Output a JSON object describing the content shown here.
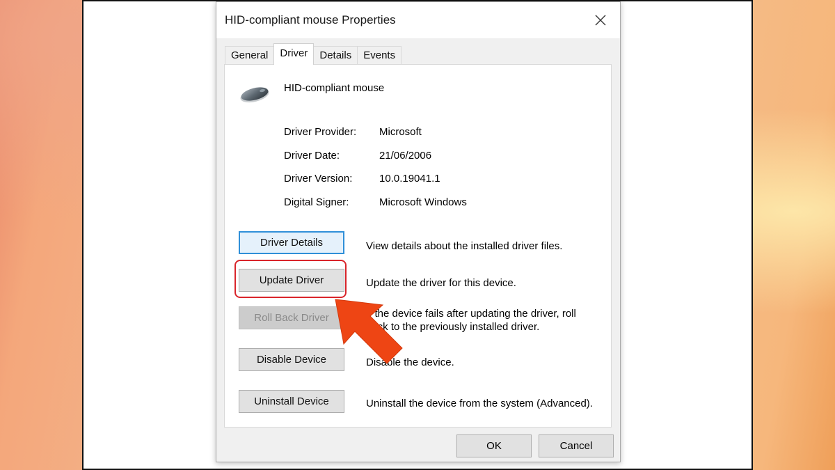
{
  "dialog": {
    "title": "HID-compliant mouse Properties",
    "close_icon": "close-icon"
  },
  "tabs": [
    {
      "label": "General",
      "active": false
    },
    {
      "label": "Driver",
      "active": true
    },
    {
      "label": "Details",
      "active": false
    },
    {
      "label": "Events",
      "active": false
    }
  ],
  "device": {
    "icon": "mouse-icon",
    "name": "HID-compliant mouse"
  },
  "driver_info": [
    {
      "label": "Driver Provider:",
      "value": "Microsoft"
    },
    {
      "label": "Driver Date:",
      "value": "21/06/2006"
    },
    {
      "label": "Driver Version:",
      "value": "10.0.19041.1"
    },
    {
      "label": "Digital Signer:",
      "value": "Microsoft Windows"
    }
  ],
  "actions": [
    {
      "label": "Driver Details",
      "description": "View details about the installed driver files.",
      "state": "focused"
    },
    {
      "label": "Update Driver",
      "description": "Update the driver for this device.",
      "state": "highlighted"
    },
    {
      "label": "Roll Back Driver",
      "description": "If the device fails after updating the driver, roll back to the previously installed driver.",
      "state": "disabled"
    },
    {
      "label": "Disable Device",
      "description": "Disable the device.",
      "state": "normal"
    },
    {
      "label": "Uninstall Device",
      "description": "Uninstall the device from the system (Advanced).",
      "state": "normal"
    }
  ],
  "footer": {
    "ok_label": "OK",
    "cancel_label": "Cancel"
  },
  "annotation": {
    "arrow_icon": "pointer-arrow-icon",
    "ring_color": "#d9252b",
    "arrow_color": "#ee4514"
  }
}
